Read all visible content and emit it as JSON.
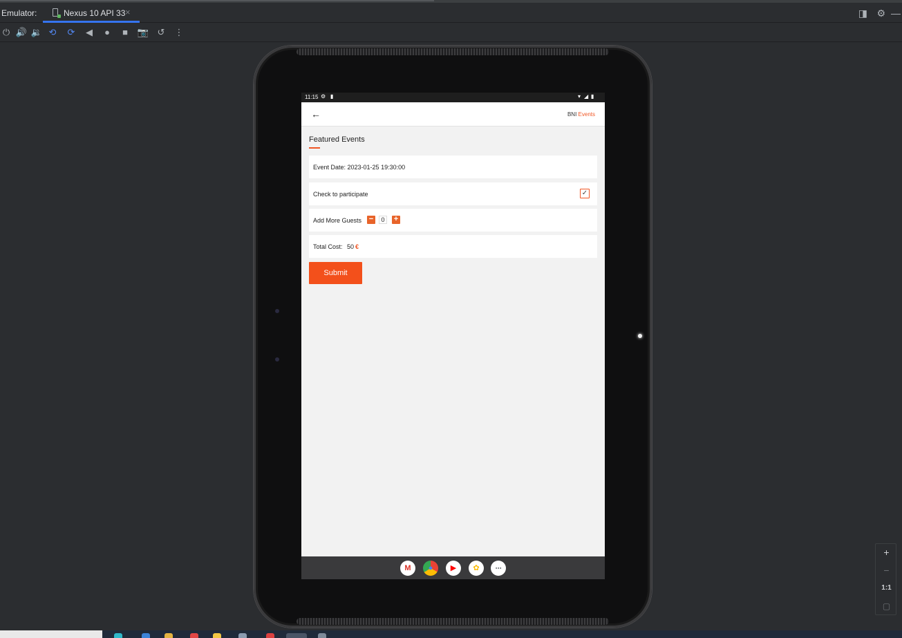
{
  "ide": {
    "emulator_label": "Emulator:",
    "device_tab": "Nexus 10 API 33",
    "tab_close_glyph": "×"
  },
  "toolbar": {
    "icons": [
      "power-icon",
      "volume-up-icon",
      "volume-down-icon",
      "rotate-left-icon",
      "rotate-right-icon",
      "back-icon",
      "home-icon",
      "overview-icon",
      "screenshot-icon",
      "snapshot-icon",
      "more-icon"
    ]
  },
  "status_bar": {
    "time": "11:15"
  },
  "app_bar": {
    "back_glyph": "←",
    "brand_prefix": "BNI",
    "brand_accent": "Events"
  },
  "page": {
    "section_title": "Featured Events",
    "event_date_label": "Event Date: 2023-01-25 19:30:00",
    "participate_label": "Check to participate",
    "participate_checked": true,
    "checkmark": "✓",
    "guests_label": "Add More Guests",
    "guests_minus": "−",
    "guests_count": "0",
    "guests_plus": "+",
    "total_cost_label": "Total Cost:",
    "total_cost_value": "50",
    "currency": "€",
    "submit_label": "Submit"
  },
  "dock": {
    "apps": [
      "gmail-icon",
      "chrome-icon",
      "youtube-icon",
      "photos-icon",
      "app-drawer-icon"
    ]
  },
  "zoom": {
    "zoom_in": "+",
    "zoom_out": "−",
    "actual_size": "1:1"
  },
  "colors": {
    "accent": "#f05523",
    "submit": "#f3501b",
    "ide_bg": "#2b2d30",
    "tab_underline": "#3574f0"
  }
}
